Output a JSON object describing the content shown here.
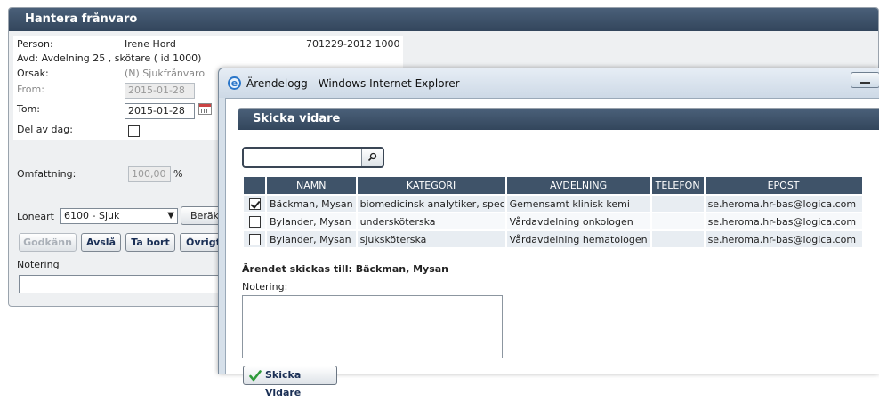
{
  "background_panel": {
    "title": "Hantera frånvaro",
    "person_label": "Person:",
    "person_name": "Irene Hord",
    "person_id": "701229-2012 1000",
    "avd_line": "Avd: Avdelning 25 , skötare ( id 1000)",
    "orsak_label": "Orsak:",
    "orsak_value": "(N) Sjukfrånvaro",
    "from_label": "From:",
    "from_value": "2015-01-28",
    "tom_label": "Tom:",
    "tom_value": "2015-01-28",
    "del_av_dag_label": "Del av dag:",
    "omfattning_label": "Omfattning:",
    "omfattning_value": "100,00",
    "omfattning_unit": "%",
    "loneart_label": "Löneart",
    "loneart_value": "6100 - Sjuk",
    "berakna_label": "Beräk",
    "buttons": {
      "godkann": "Godkänn",
      "avsla": "Avslå",
      "ta_bort": "Ta bort",
      "ovrigt": "Övrigt"
    },
    "notering_label": "Notering"
  },
  "ie_window": {
    "title": "Ärendelogg - Windows Internet Explorer",
    "dialog_title": "Skicka vidare",
    "search_value": "",
    "table": {
      "headers": [
        "",
        "NAMN",
        "KATEGORI",
        "AVDELNING",
        "TELEFON",
        "EPOST"
      ],
      "rows": [
        {
          "checked": true,
          "namn": "Bäckman, Mysan",
          "kategori": "biomedicinsk analytiker, spec",
          "avdelning": "Gemensamt klinisk kemi",
          "telefon": "",
          "epost": "se.heroma.hr-bas@logica.com"
        },
        {
          "checked": false,
          "namn": "Bylander, Mysan",
          "kategori": "undersköterska",
          "avdelning": "Vårdavdelning onkologen",
          "telefon": "",
          "epost": "se.heroma.hr-bas@logica.com"
        },
        {
          "checked": false,
          "namn": "Bylander, Mysan",
          "kategori": "sjuksköterska",
          "avdelning": "Vårdavdelning hematologen",
          "telefon": "",
          "epost": "se.heroma.hr-bas@logica.com"
        }
      ]
    },
    "send_to": "Ärendet skickas till: Bäckman, Mysan",
    "notering_label": "Notering:",
    "notering_value": "",
    "send_button": "Skicka Vidare"
  },
  "colors": {
    "header_bg": "#3f5369",
    "row_odd": "#e8edf2",
    "row_even": "#f7f9fb",
    "send_icon": "#2e9a3a"
  },
  "icons": [
    "calendar-icon",
    "search-icon",
    "ie-logo-icon",
    "minimize-icon",
    "checkmark-icon",
    "scroll-up-icon",
    "scroll-down-icon",
    "dropdown-arrow-icon"
  ]
}
